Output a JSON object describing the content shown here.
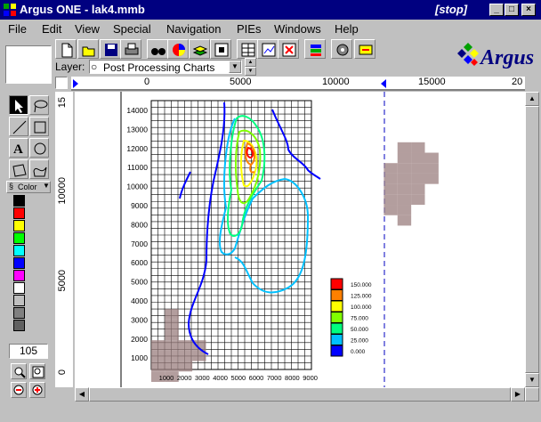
{
  "window": {
    "title": "Argus ONE - lak4.mmb",
    "status_tag": "[stop]",
    "minimize": "_",
    "maximize": "□",
    "close": "×"
  },
  "menu": [
    "File",
    "Edit",
    "View",
    "Special",
    "Navigation",
    "PIEs",
    "Windows",
    "Help"
  ],
  "toolbar": {
    "icons": [
      "new-file-icon",
      "open-folder-icon",
      "save-disk-icon",
      "print-icon",
      "find-binoculars-icon",
      "color-wheel-icon",
      "layers-stack-icon",
      "grid-frame-icon",
      "table-icon",
      "chart-icon",
      "delete-icon",
      "stacked-books-icon",
      "settings-icon",
      "pie-export-icon"
    ]
  },
  "logo": {
    "text": "Argus"
  },
  "layer": {
    "label": "Layer:",
    "value": "Post Processing Charts"
  },
  "color_panel": {
    "label": "Color",
    "colors": [
      "#000000",
      "#ff0000",
      "#ffff00",
      "#00ff00",
      "#00ffff",
      "#0000ff",
      "#ff00ff",
      "#ffffff",
      "#c0c0c0",
      "#808080",
      "#606060"
    ]
  },
  "zoom": {
    "value": "105"
  },
  "ruler": {
    "top_labels": [
      "0",
      "5000",
      "10000",
      "15000",
      "20"
    ],
    "left_labels": [
      "15",
      "10000",
      "5000",
      "0"
    ]
  },
  "chart": {
    "y_ticks": [
      "14000",
      "13000",
      "12000",
      "11000",
      "10000",
      "9000",
      "8000",
      "7000",
      "6000",
      "5000",
      "4000",
      "3000",
      "2000",
      "1000"
    ],
    "x_ticks": [
      "1000",
      "2000",
      "3000",
      "4000",
      "5000",
      "6000",
      "7000",
      "8000",
      "9000"
    ],
    "legend": [
      {
        "label": "150.000",
        "color": "#ff0000"
      },
      {
        "label": "125.000",
        "color": "#ff8000"
      },
      {
        "label": "100.000",
        "color": "#ffff00"
      },
      {
        "label": "75.000",
        "color": "#80ff00"
      },
      {
        "label": "50.000",
        "color": "#00ff80"
      },
      {
        "label": "25.000",
        "color": "#00c0ff"
      },
      {
        "label": "0.000",
        "color": "#0000ff"
      }
    ]
  }
}
